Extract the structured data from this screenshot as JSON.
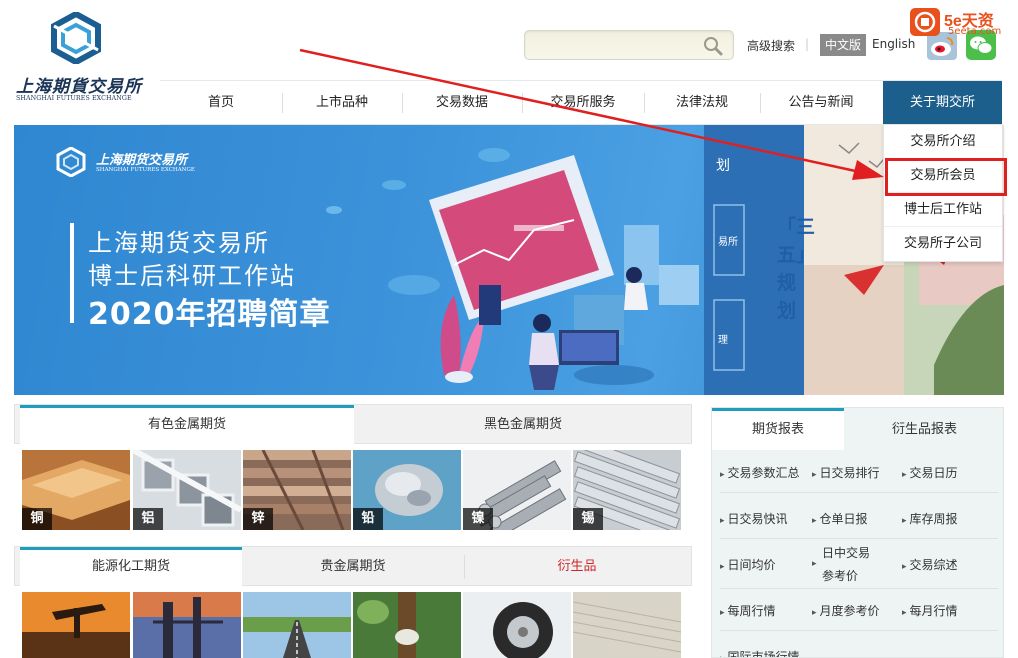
{
  "logo": {
    "name_cn": "上海期貨交易所",
    "name_en": "SHANGHAI FUTURES EXCHANGE"
  },
  "header": {
    "search_placeholder": "",
    "advanced_search": "高级搜索",
    "separator": "|",
    "lang_cn": "中文版",
    "lang_en": "English"
  },
  "watermark": {
    "brand": "5e天资",
    "url": "5eeta.com"
  },
  "nav": {
    "items": [
      "首页",
      "上市品种",
      "交易数据",
      "交易所服务",
      "法律法规",
      "公告与新闻",
      "关于期交所"
    ],
    "active_index": 6
  },
  "dropdown": {
    "items": [
      "交易所介绍",
      "交易所会员",
      "博士后工作站",
      "交易所子公司"
    ],
    "highlighted_index": 1
  },
  "banner": {
    "logo_cn": "上海期货交易所",
    "logo_en": "SHANGHAI FUTURES EXCHANGE",
    "line1": "上海期货交易所",
    "line2": "博士后科研工作站",
    "line3": "2020年招聘简章",
    "peek_top": "划",
    "peek_mid": "易所",
    "peek_low": "理",
    "vertical_text": "「三五」规划"
  },
  "product_tabs_1": {
    "tabs": [
      "有色金属期货",
      "黑色金属期货"
    ],
    "active_index": 0,
    "tiles": [
      "铜",
      "铝",
      "锌",
      "铅",
      "镍",
      "锡"
    ]
  },
  "product_tabs_2": {
    "tabs": [
      "能源化工期货",
      "贵金属期货",
      "衍生品"
    ],
    "active_index": 0
  },
  "reports": {
    "tabs": [
      "期货报表",
      "衍生品报表"
    ],
    "active_index": 0,
    "rows": [
      [
        "交易参数汇总",
        "日交易排行",
        "交易日历"
      ],
      [
        "日交易快讯",
        "仓单日报",
        "库存周报"
      ],
      [
        "日间均价",
        "日中交易参考价",
        "交易综述"
      ],
      [
        "每周行情",
        "月度参考价",
        "每月行情"
      ],
      [
        "国际市场行情",
        "",
        ""
      ]
    ]
  },
  "colors": {
    "nav_active": "#1c5f8c",
    "accent_tab": "#1f9dc0",
    "highlight_red": "#e02020",
    "banner_blue": "#3d93da"
  }
}
